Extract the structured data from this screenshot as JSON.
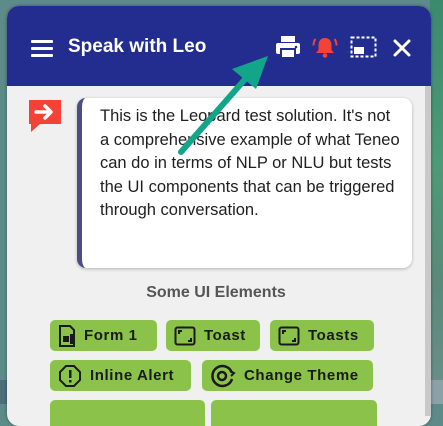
{
  "header": {
    "title": "Speak with Leo",
    "icons": [
      "menu-icon",
      "print-icon",
      "alarm-icon",
      "resize-icon",
      "close-icon"
    ]
  },
  "message": {
    "text": "This is the Leopard test solution. It's not a comprehensive example of what Teneo can do in terms of NLP or NLU but tests the UI components that can be triggered through conversation."
  },
  "section": {
    "title": "Some UI Elements"
  },
  "quick_replies": [
    {
      "label": "Form 1",
      "icon": "form-icon"
    },
    {
      "label": "Toast",
      "icon": "toast-icon"
    },
    {
      "label": "Toasts",
      "icon": "toasts-icon"
    },
    {
      "label": "Inline Alert",
      "icon": "alert-icon"
    },
    {
      "label": "Change Theme",
      "icon": "theme-icon"
    }
  ],
  "colors": {
    "header": "#232d8f",
    "accent_red": "#f44336",
    "button_green": "#8bc34a",
    "annotation_arrow": "#13a58a"
  }
}
